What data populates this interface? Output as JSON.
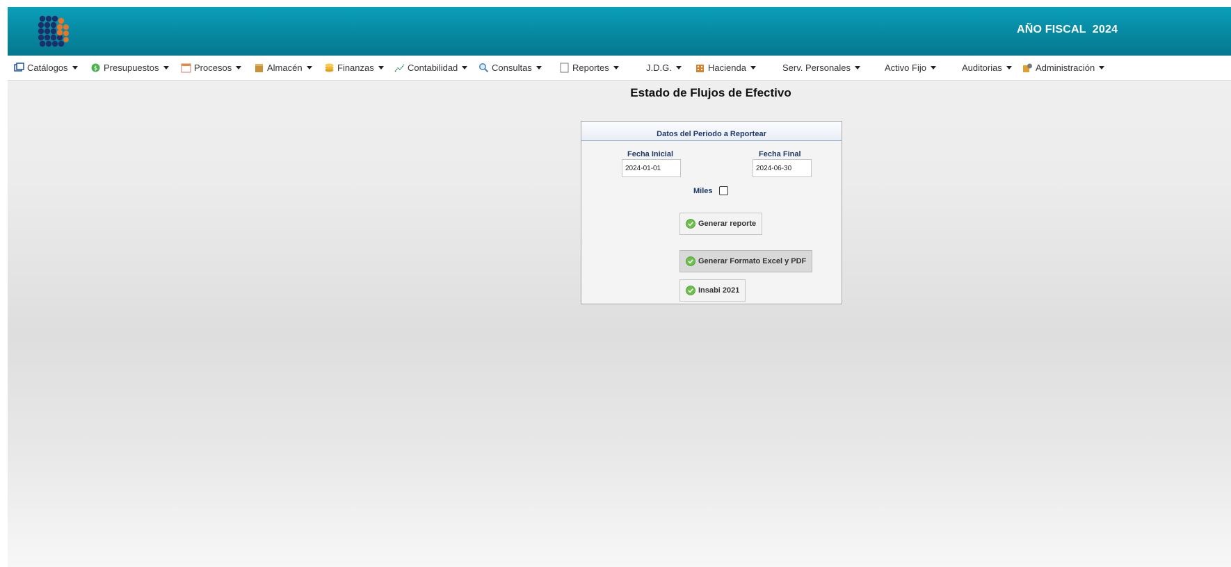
{
  "header": {
    "fiscal_year_text": "AÑO FISCAL  2024",
    "logo_icon": "grid-dots-logo"
  },
  "menu": [
    {
      "label": "Catálogos",
      "icon": "window-icon"
    },
    {
      "label": "Presupuestos",
      "icon": "money-icon"
    },
    {
      "label": "Procesos",
      "icon": "calendar-icon"
    },
    {
      "label": "Almacén",
      "icon": "box-icon"
    },
    {
      "label": "Finanzas",
      "icon": "coins-icon"
    },
    {
      "label": "Contabilidad",
      "icon": "chart-line-icon"
    },
    {
      "label": "Consultas",
      "icon": "magnifier-icon"
    },
    {
      "label": "Reportes",
      "icon": "document-icon"
    },
    {
      "label": "J.D.G.",
      "icon": ""
    },
    {
      "label": "Hacienda",
      "icon": "building-icon"
    },
    {
      "label": "Serv. Personales",
      "icon": ""
    },
    {
      "label": "Activo Fijo",
      "icon": ""
    },
    {
      "label": "Auditorias",
      "icon": ""
    },
    {
      "label": "Administración",
      "icon": "admin-icon"
    }
  ],
  "page": {
    "title": "Estado de Flujos de Efectivo"
  },
  "panel": {
    "heading": "Datos del Periodo a Reportear",
    "fecha_inicial_label": "Fecha Inicial",
    "fecha_inicial_value": "2024-01-01",
    "fecha_final_label": "Fecha Final",
    "fecha_final_value": "2024-06-30",
    "miles_label": "Miles",
    "miles_checked": false
  },
  "buttons": {
    "generar_reporte": "Generar reporte",
    "generar_excel_pdf": "Generar Formato Excel y PDF",
    "insabi": "Insabi 2021"
  },
  "colors": {
    "header_teal": "#078aa3",
    "label_blue": "#1f3a68"
  }
}
